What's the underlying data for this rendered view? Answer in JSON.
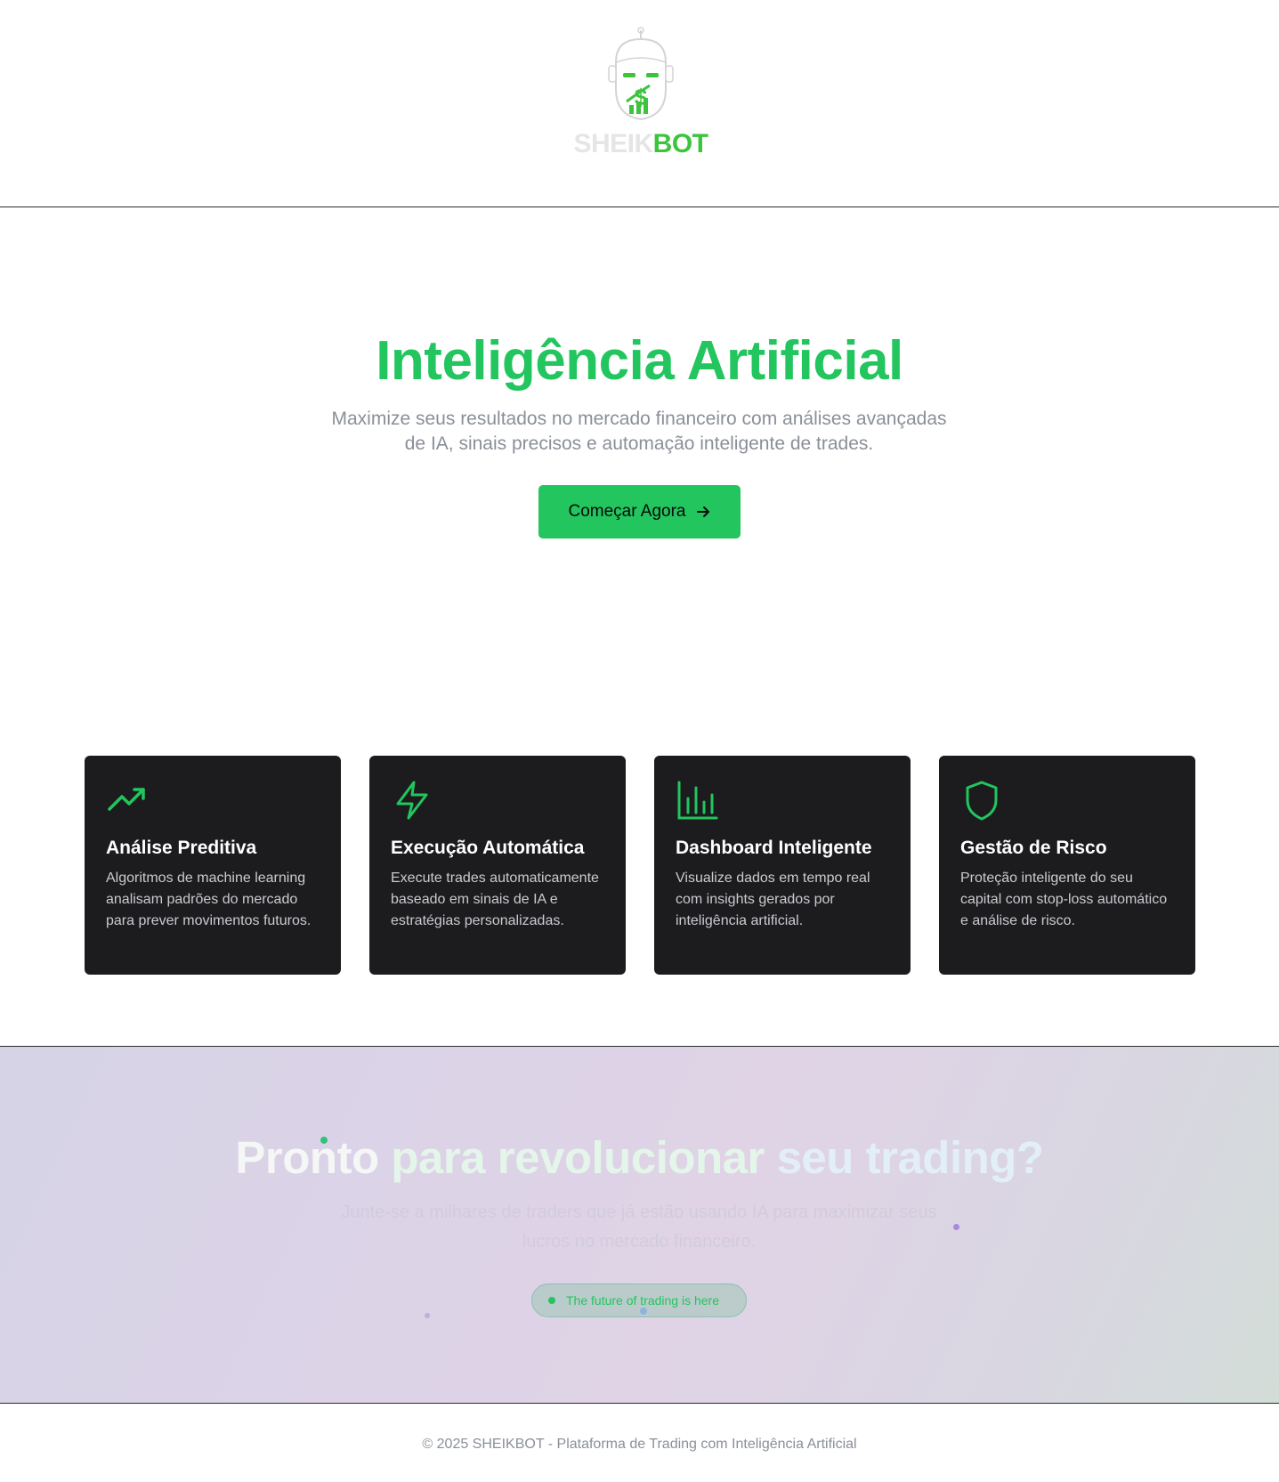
{
  "brand": {
    "name_part1": "SHEIK",
    "name_part2": "BOT",
    "accent_color": "#22c55e",
    "logo_icon": "robot-dollar-icon"
  },
  "hero": {
    "title": "Inteligência Artificial",
    "subtitle": "Maximize seus resultados no mercado financeiro com análises avançadas de IA, sinais precisos e automação inteligente de trades.",
    "cta_label": "Começar Agora",
    "cta_icon": "arrow-right-icon"
  },
  "features": [
    {
      "icon": "trending-up-icon",
      "title": "Análise Preditiva",
      "description": "Algoritmos de machine learning analisam padrões do mercado para prever movimentos futuros."
    },
    {
      "icon": "lightning-icon",
      "title": "Execução Automática",
      "description": "Execute trades automaticamente baseado em sinais de IA e estratégias personalizadas."
    },
    {
      "icon": "bar-chart-icon",
      "title": "Dashboard Inteligente",
      "description": "Visualize dados em tempo real com insights gerados por inteligência artificial."
    },
    {
      "icon": "shield-icon",
      "title": "Gestão de Risco",
      "description": "Proteção inteligente do seu capital com stop-loss automático e análise de risco."
    }
  ],
  "cta_section": {
    "title_part1": "Pronto ",
    "title_part2": "para revolucionar ",
    "title_part3": "seu trading?",
    "subtitle": "Junte-se a milhares de traders que já estão usando IA para maximizar seus lucros no mercado financeiro.",
    "badge_label": "The future of trading is here"
  },
  "footer": {
    "copyright": "© 2025 SHEIKBOT - Plataforma de Trading com Inteligência Artificial"
  }
}
